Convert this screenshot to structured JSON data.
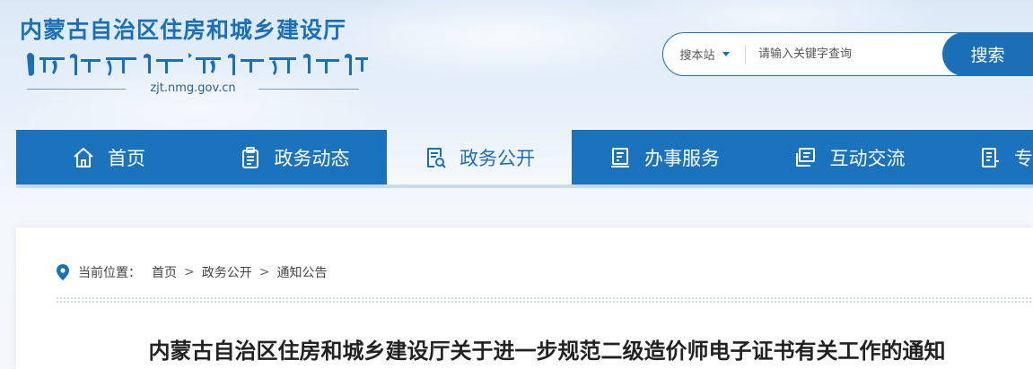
{
  "header": {
    "site_title": "内蒙古自治区住房和城乡建设厅",
    "domain": "zjt.nmg.gov.cn"
  },
  "search": {
    "scope_label": "搜本站",
    "placeholder": "请输入关键字查询",
    "button_label": "搜索"
  },
  "nav": {
    "items": [
      {
        "label": "首页",
        "icon": "home-icon"
      },
      {
        "label": "政务动态",
        "icon": "clipboard-icon"
      },
      {
        "label": "政务公开",
        "icon": "document-search-icon"
      },
      {
        "label": "办事服务",
        "icon": "service-form-icon"
      },
      {
        "label": "互动交流",
        "icon": "chat-board-icon"
      },
      {
        "label": "专",
        "icon": "topic-icon"
      }
    ],
    "active_index": 2
  },
  "breadcrumb": {
    "prefix": "当前位置：",
    "items": [
      "首页",
      "政务公开",
      "通知公告"
    ],
    "separator": ">"
  },
  "article": {
    "title": "内蒙古自治区住房和城乡建设厅关于进一步规范二级造价师电子证书有关工作的通知"
  },
  "colors": {
    "brand_blue": "#1b72bd",
    "title_blue": "#1b6fb6"
  }
}
